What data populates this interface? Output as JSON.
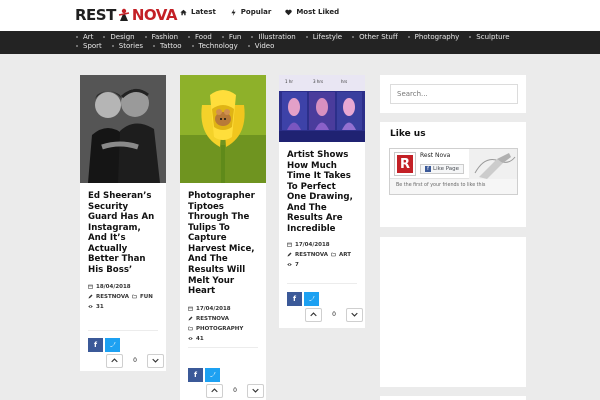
{
  "header": {
    "logo_left": "REST",
    "logo_right": "NOVA",
    "links": [
      {
        "label": "Latest",
        "icon": "home-icon"
      },
      {
        "label": "Popular",
        "icon": "bolt-icon"
      },
      {
        "label": "Most Liked",
        "icon": "heart-icon"
      }
    ]
  },
  "categories": {
    "row1": [
      "Art",
      "Design",
      "Fashion",
      "Food",
      "Fun",
      "Illustration",
      "Lifestyle",
      "Other Stuff",
      "Photography",
      "Sculpture"
    ],
    "row2": [
      "Sport",
      "Stories",
      "Tattoo",
      "Technology",
      "Video"
    ]
  },
  "posts": [
    {
      "title": "Ed Sheeran’s Security Guard Has An Instagram, And It’s Actually Better Than His Boss’",
      "date": "18/04/2018",
      "author": "RESTNOVA",
      "category": "FUN",
      "views": "31",
      "share_fb": "f",
      "share_tw": "t",
      "votes": "0"
    },
    {
      "title": "Photographer Tiptoes Through The Tulips To Capture Harvest Mice, And The Results Will Melt Your Heart",
      "date": "17/04/2018",
      "author": "RESTNOVA",
      "category": "PHOTOGRAPHY",
      "views": "41",
      "share_fb": "f",
      "share_tw": "t",
      "votes": "0"
    },
    {
      "title": "Artist Shows How Much Time It Takes To Perfect One Drawing, And The Results Are Incredible",
      "date": "17/04/2018",
      "author": "RESTNOVA",
      "category": "ART",
      "views": "7",
      "share_fb": "f",
      "share_tw": "t",
      "votes": "0"
    }
  ],
  "sidebar": {
    "search_placeholder": "Search...",
    "like_title": "Like us",
    "fb_page_name": "Rest Nova",
    "fb_like_label": "Like Page",
    "fb_logo_letter": "R",
    "fb_friends_text": "Be the first of your friends to like this"
  },
  "colors": {
    "brand_red": "#c32026",
    "nav_bg": "#232323",
    "facebook": "#3b5998",
    "twitter": "#1da1f2"
  }
}
